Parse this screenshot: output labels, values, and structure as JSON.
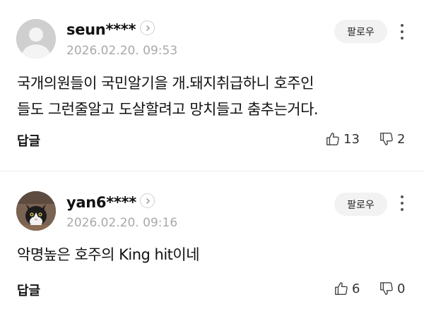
{
  "comments": [
    {
      "nickname": "seun****",
      "date": "2026.02.20. 09:53",
      "follow_label": "팔로우",
      "text_lines": [
        "국개의원들이 국민알기을 개.돼지취급하니 호주인",
        "들도 그런줄알고 도살할려고 망치들고 춤추는거다."
      ],
      "reply_label": "답글",
      "likes": "13",
      "dislikes": "2",
      "avatar": "default-avatar"
    },
    {
      "nickname": "yan6****",
      "date": "2026.02.20. 09:16",
      "follow_label": "팔로우",
      "text_lines": [
        "악명높은 호주의 King hit이네"
      ],
      "reply_label": "답글",
      "likes": "6",
      "dislikes": "0",
      "avatar": "cat-avatar"
    }
  ],
  "icons": {
    "chevron": "chevron-right-icon",
    "more": "more-vertical-icon",
    "like": "thumbs-up-icon",
    "dislike": "thumbs-down-icon"
  },
  "colors": {
    "date": "#a9a9a9",
    "follow_bg": "#f2f2f2",
    "divider": "#ececec"
  }
}
